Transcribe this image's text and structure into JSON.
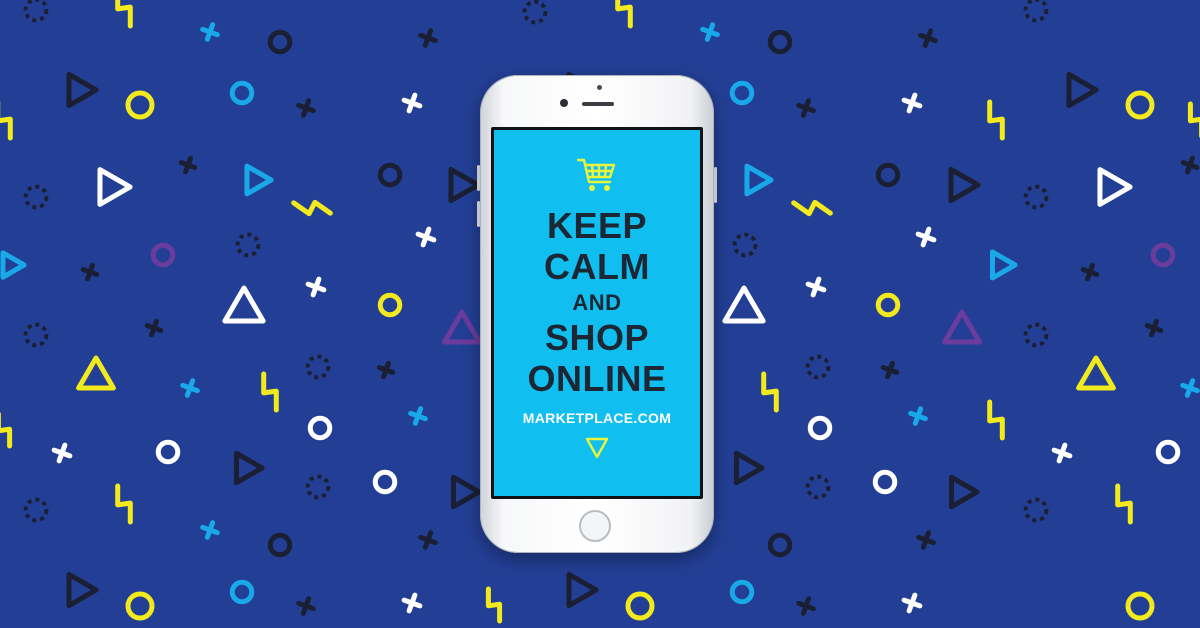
{
  "poster": {
    "line1": "KEEP",
    "line2": "CALM",
    "line3": "AND",
    "line4": "SHOP",
    "line5": "ONLINE",
    "website": "MARKETPLACE.COM"
  },
  "icons": {
    "top": "shopping-cart-icon",
    "bottom": "down-triangle-icon"
  },
  "colors": {
    "background": "#233f95",
    "screen": "#10bff0",
    "headline_text": "#1c2735",
    "accent_yellow": "#f2ea1d",
    "shape_white": "#ffffff",
    "shape_sky": "#19a9e9",
    "shape_dark": "#1a1f33",
    "shape_purple": "#6a3c9c"
  }
}
